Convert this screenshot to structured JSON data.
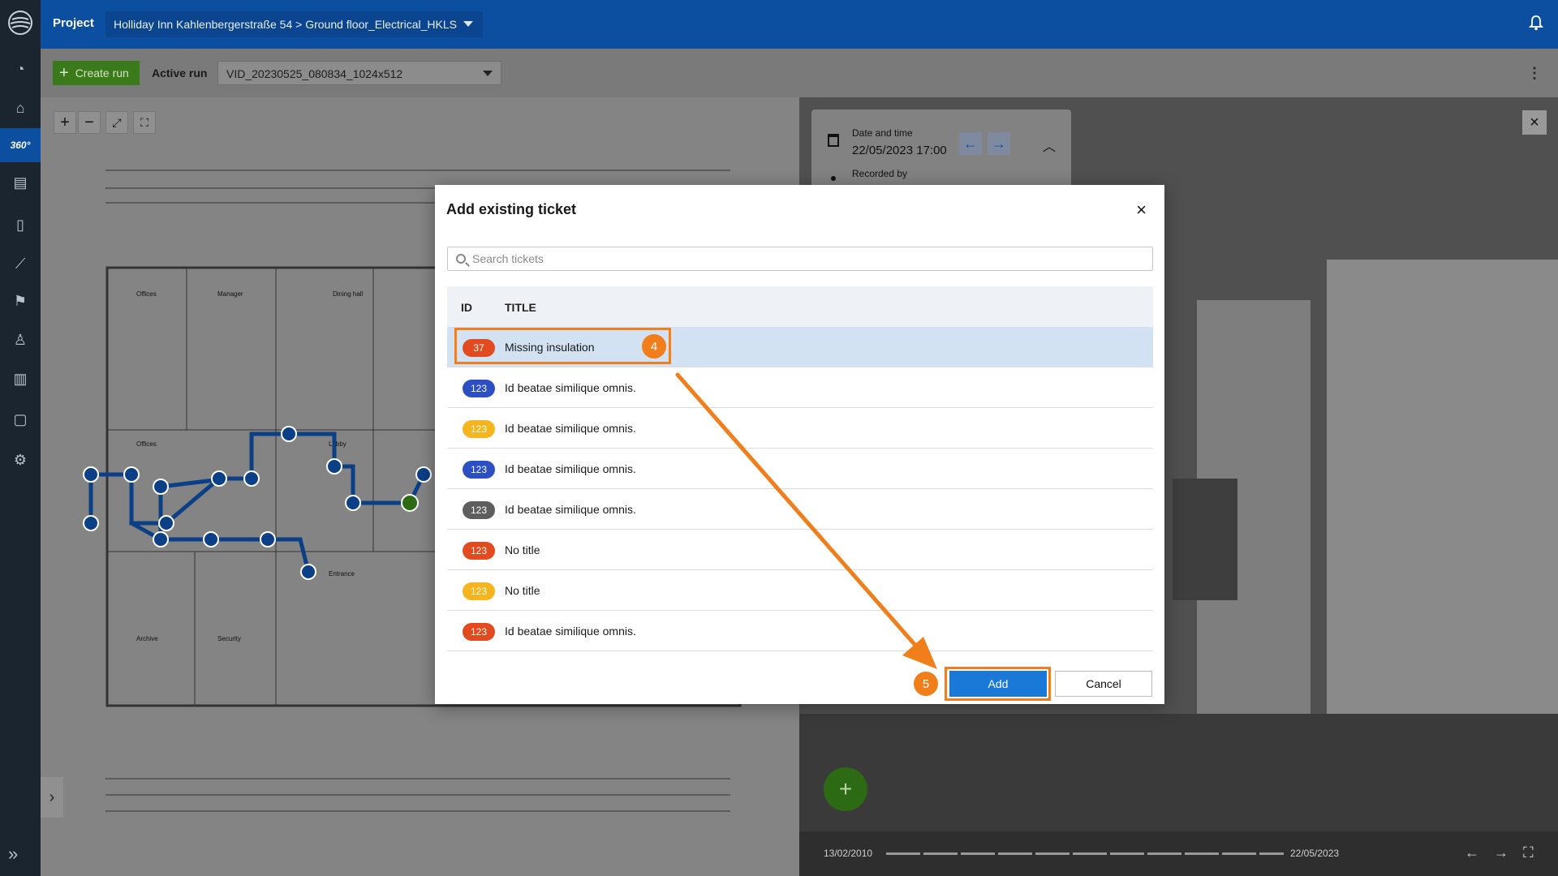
{
  "rail": {
    "items": [
      "dashboard-icon",
      "tag-icon",
      "360-icon",
      "report-icon",
      "document-icon",
      "ruler-icon",
      "flag-icon",
      "user-icon",
      "chart-icon",
      "clipboard-icon",
      "settings-icon"
    ],
    "active_label": "360°"
  },
  "header": {
    "project_label": "Project",
    "project_path": "Holliday Inn Kahlenbergerstraße 54 > Ground floor_Electrical_HKLS"
  },
  "toolbar": {
    "create_run_label": "Create run",
    "active_run_label": "Active run",
    "active_run_value": "VID_20230525_080834_1024x512"
  },
  "plan": {
    "room_labels": [
      "Offices",
      "Manager",
      "Dining hall",
      "Offices",
      "Lobby",
      "Entrance",
      "Archive",
      "Security"
    ]
  },
  "viewer": {
    "date_label": "Date and time",
    "date_value": "22/05/2023 17:00",
    "recorded_label": "Recorded by",
    "timeline_start": "13/02/2010",
    "timeline_end": "22/05/2023"
  },
  "modal": {
    "title": "Add existing ticket",
    "search_placeholder": "Search tickets",
    "col_id": "ID",
    "col_title": "TITLE",
    "rows": [
      {
        "id": "37",
        "title": "Missing insulation",
        "color": "#e14b1f"
      },
      {
        "id": "123",
        "title": "Id beatae similique omnis.",
        "color": "#2c4fc1"
      },
      {
        "id": "123",
        "title": "Id beatae similique omnis.",
        "color": "#f6b51e"
      },
      {
        "id": "123",
        "title": "Id beatae similique omnis.",
        "color": "#2c4fc1"
      },
      {
        "id": "123",
        "title": "Id beatae similique omnis.",
        "color": "#5e5e5e"
      },
      {
        "id": "123",
        "title": "No title",
        "color": "#e14b1f"
      },
      {
        "id": "123",
        "title": "No title",
        "color": "#f6b51e"
      },
      {
        "id": "123",
        "title": "Id beatae similique omnis.",
        "color": "#e14b1f"
      }
    ],
    "add_label": "Add",
    "cancel_label": "Cancel",
    "step4": "4",
    "step5": "5"
  },
  "colors": {
    "brand_blue": "#0c4fa0",
    "annotation_orange": "#f07e1b",
    "selected_row": "#d2e2f2"
  }
}
